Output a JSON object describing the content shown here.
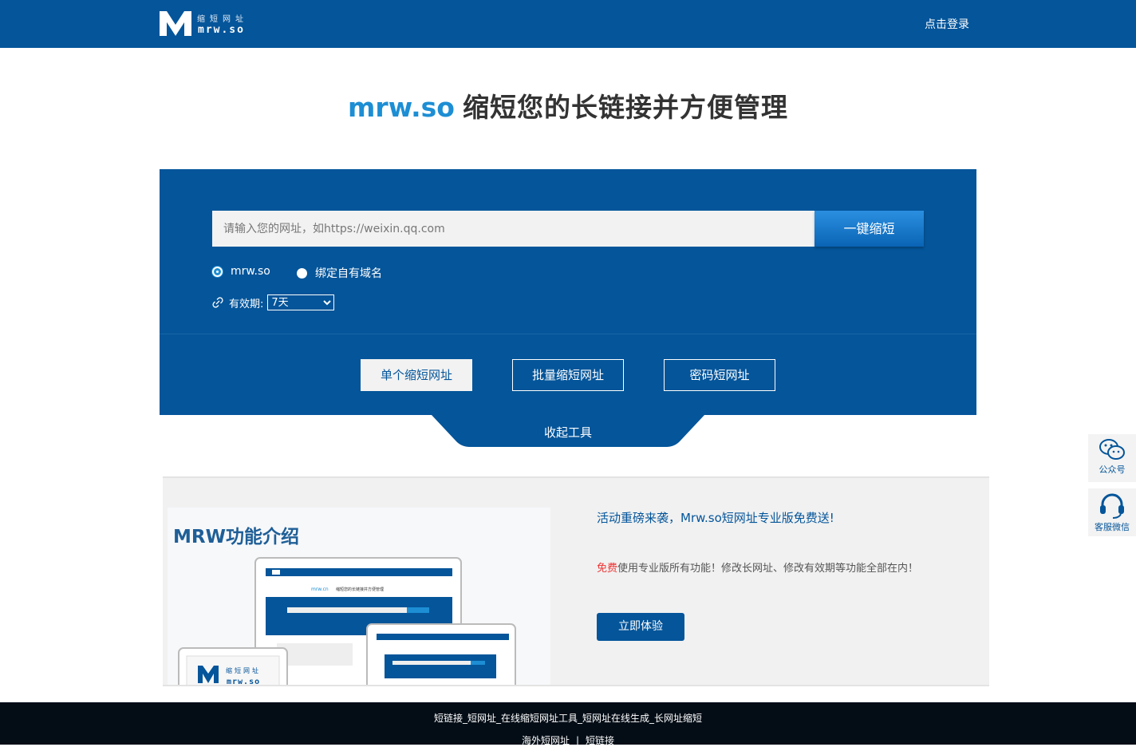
{
  "header": {
    "logo_cn": "缩短网址",
    "logo_en": "mrw.so",
    "login_label": "点击登录"
  },
  "hero": {
    "brand": "mrw.so",
    "tagline": "缩短您的长链接并方便管理"
  },
  "shortener": {
    "url_placeholder": "请输入您的网址，如https://weixin.qq.com",
    "url_value": "",
    "submit_label": "一键缩短",
    "domain_options": [
      {
        "label": "mrw.so",
        "selected": true
      },
      {
        "label": "绑定自有域名",
        "selected": false
      }
    ],
    "validity_label": "有效期:",
    "validity_selected": "7天",
    "modes": [
      {
        "label": "单个缩短网址",
        "active": true
      },
      {
        "label": "批量缩短网址",
        "active": false
      },
      {
        "label": "密码短网址",
        "active": false
      }
    ],
    "collapse_label": "收起工具"
  },
  "sidebar": {
    "items": [
      {
        "label": "公众号",
        "icon": "wechat-icon"
      },
      {
        "label": "客服微信",
        "icon": "headset-icon"
      }
    ]
  },
  "promo": {
    "image_title": "MRW功能介绍",
    "headline": "活动重磅来袭，Mrw.so短网址专业版免费送!",
    "desc_highlight": "免费",
    "desc_rest": "使用专业版所有功能！修改长网址、修改有效期等功能全部在内！",
    "cta_label": "立即体验",
    "mock_brand": "mrw.cn",
    "mock_tagline": "缩短您的长链接并方便管理"
  },
  "footer": {
    "line1": "短链接_短网址_在线缩短网址工具_短网址在线生成_长网址缩短",
    "links": [
      "海外短网址",
      "短链接"
    ],
    "separator": "|"
  },
  "colors": {
    "primary": "#04559a",
    "accent": "#1d8ed4",
    "footer_bg": "#040d16",
    "highlight": "#ee3333"
  }
}
